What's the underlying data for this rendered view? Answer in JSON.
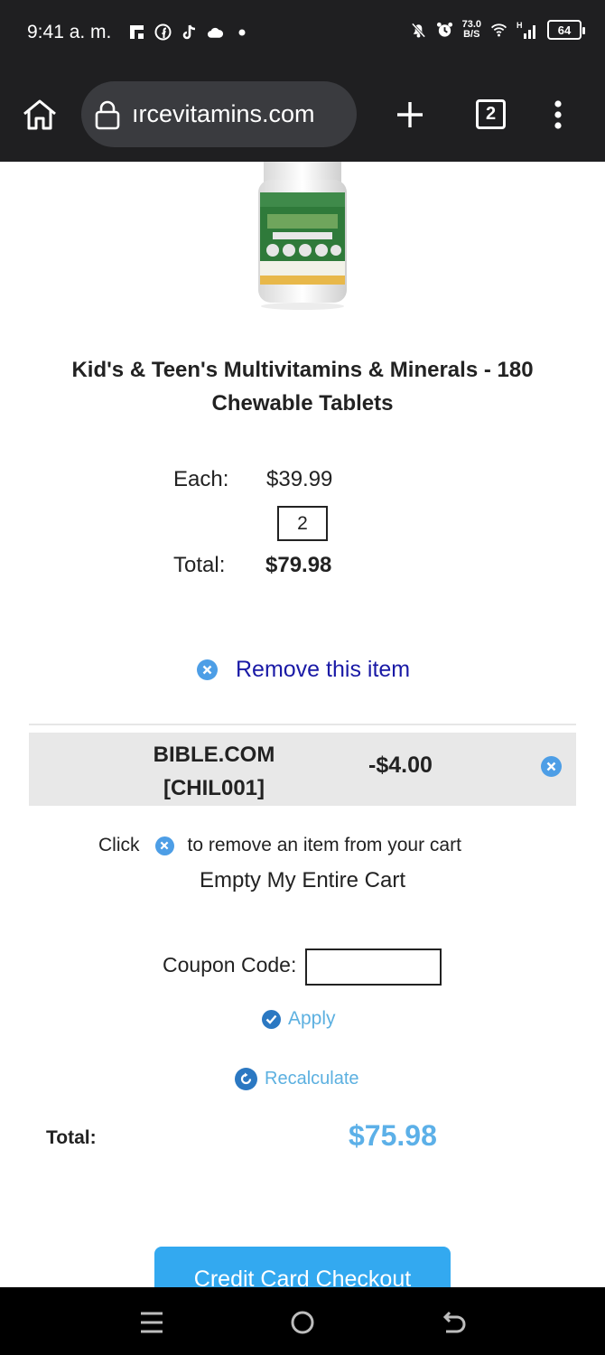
{
  "status_bar": {
    "time": "9:41 a. m.",
    "network_speed_value": "73.0",
    "network_speed_unit": "B/S",
    "signal_type": "H",
    "battery": "64"
  },
  "browser": {
    "url": "ırcevitamins.com",
    "tab_count": "2"
  },
  "product": {
    "image_alt": "vitamin bottle",
    "title": "Kid's & Teen's Multivitamins & Minerals - 180 Chewable Tablets",
    "each_label": "Each:",
    "each_price": "$39.99",
    "quantity": "2",
    "total_label": "Total:",
    "total_price": "$79.98",
    "remove_label": "Remove this item"
  },
  "coupon_applied": {
    "name": "BIBLE.COM [CHIL001]",
    "amount": "-$4.00"
  },
  "cart_actions": {
    "hint_prefix": "Click",
    "hint_suffix": "to remove an item from your cart",
    "empty_cart_label": "Empty My Entire Cart",
    "coupon_code_label": "Coupon Code:",
    "coupon_code_value": "",
    "apply_label": "Apply",
    "recalculate_label": "Recalculate"
  },
  "summary": {
    "total_label": "Total:",
    "total_value": "$75.98",
    "checkout_label": "Credit Card Checkout"
  },
  "colors": {
    "link_blue": "#1a1aa6",
    "accent_light_blue": "#5cb0e0",
    "checkout_button": "#33a9f0",
    "icon_blue": "#4d9ee6"
  },
  "icons": {
    "home": "home-icon",
    "lock": "lock-icon",
    "new_tab": "plus-icon",
    "menu": "kebab-menu-icon",
    "remove": "x-circle-icon",
    "apply": "check-circle-icon",
    "recalculate": "refresh-icon"
  }
}
